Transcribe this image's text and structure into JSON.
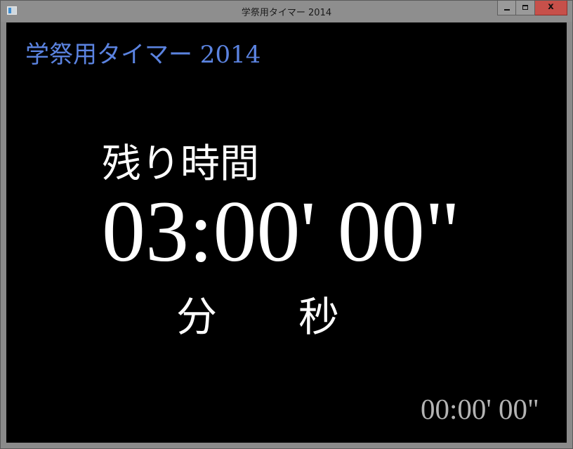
{
  "window": {
    "title": "学祭用タイマー 2014",
    "icon": "app-window-icon",
    "close_glyph": "x"
  },
  "app": {
    "heading": "学祭用タイマー 2014",
    "heading_color": "#5b83e0"
  },
  "timer": {
    "remaining_label": "残り時間",
    "remaining_time": "03:00' 00\"",
    "minute_unit": "分",
    "second_unit": "秒",
    "elapsed_time": "00:00' 00\""
  }
}
